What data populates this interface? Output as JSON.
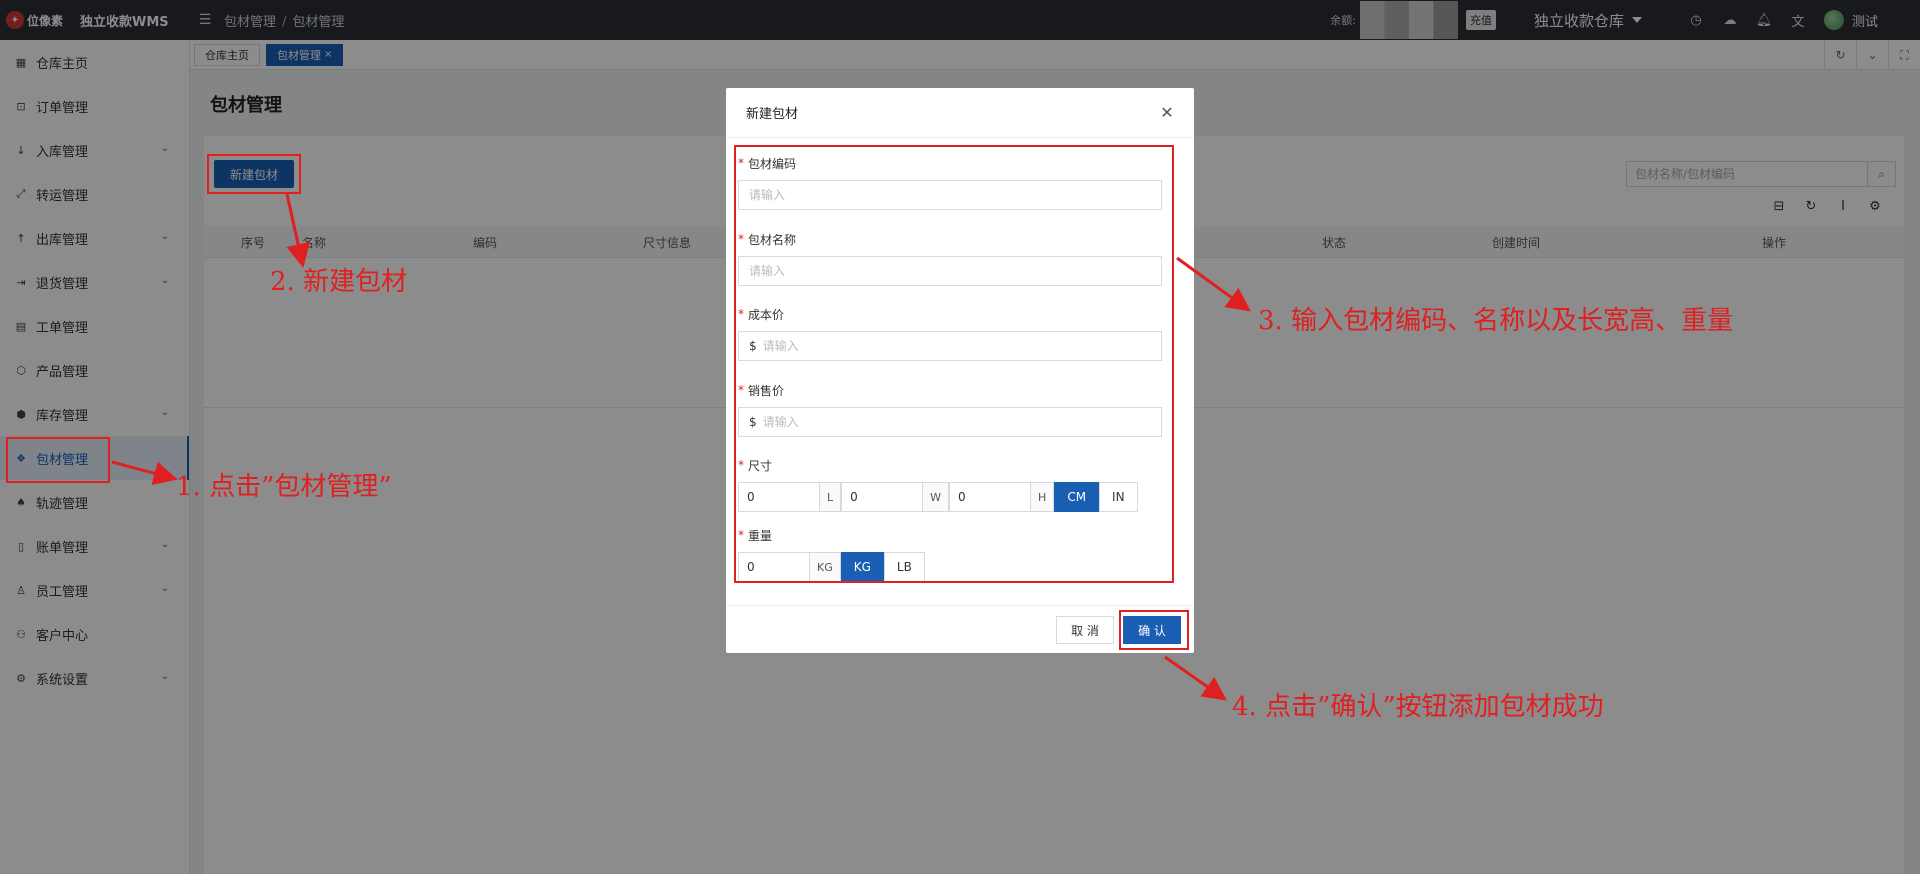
{
  "app": {
    "brand": "位像素",
    "title": "独立收款WMS"
  },
  "header": {
    "breadcrumb": [
      "包材管理",
      "包材管理"
    ],
    "balance_label": "余额:",
    "recharge_label": "充值",
    "warehouse": "独立收款仓库",
    "username": "测试",
    "icons": [
      "clock-icon",
      "cloud-upload-icon",
      "bell-icon",
      "translate-icon"
    ]
  },
  "sidebar": {
    "items": [
      {
        "label": "仓库主页",
        "icon": "grid-icon",
        "has_children": false
      },
      {
        "label": "订单管理",
        "icon": "order-icon",
        "has_children": false
      },
      {
        "label": "入库管理",
        "icon": "arrow-down-icon",
        "has_children": true
      },
      {
        "label": "转运管理",
        "icon": "transfer-icon",
        "has_children": false
      },
      {
        "label": "出库管理",
        "icon": "arrow-up-icon",
        "has_children": true
      },
      {
        "label": "退货管理",
        "icon": "return-icon",
        "has_children": true
      },
      {
        "label": "工单管理",
        "icon": "ticket-icon",
        "has_children": false
      },
      {
        "label": "产品管理",
        "icon": "cube-icon",
        "has_children": false
      },
      {
        "label": "库存管理",
        "icon": "inventory-icon",
        "has_children": true
      },
      {
        "label": "包材管理",
        "icon": "dropbox-icon",
        "has_children": false
      },
      {
        "label": "轨迹管理",
        "icon": "track-icon",
        "has_children": false
      },
      {
        "label": "账单管理",
        "icon": "bill-icon",
        "has_children": true
      },
      {
        "label": "员工管理",
        "icon": "user-icon",
        "has_children": true
      },
      {
        "label": "客户中心",
        "icon": "customer-icon",
        "has_children": false
      },
      {
        "label": "系统设置",
        "icon": "gear-icon",
        "has_children": true
      }
    ],
    "active_index": 9
  },
  "tabs": [
    {
      "label": "仓库主页",
      "active": false
    },
    {
      "label": "包材管理",
      "active": true
    }
  ],
  "page": {
    "title": "包材管理",
    "new_button": "新建包材",
    "search_placeholder": "包材名称/包材编码",
    "columns": [
      "序号",
      "名称",
      "编码",
      "尺寸信息",
      "状态",
      "创建时间",
      "操作"
    ]
  },
  "modal": {
    "title": "新建包材",
    "fields": {
      "code_label": "包材编码",
      "code_placeholder": "请输入",
      "name_label": "包材名称",
      "name_placeholder": "请输入",
      "cost_label": "成本价",
      "cost_prefix": "$",
      "cost_placeholder": "请输入",
      "price_label": "销售价",
      "price_prefix": "$",
      "price_placeholder": "请输入",
      "size_label": "尺寸",
      "length_value": "0",
      "length_unit": "L",
      "width_value": "0",
      "width_unit": "W",
      "height_value": "0",
      "height_unit": "H",
      "size_units": [
        "CM",
        "IN"
      ],
      "size_unit_selected": "CM",
      "weight_label": "重量",
      "weight_value": "0",
      "weight_unit": "KG",
      "weight_units": [
        "KG",
        "LB"
      ],
      "weight_unit_selected": "KG"
    },
    "cancel_label": "取 消",
    "ok_label": "确 认"
  },
  "annotations": {
    "step1": "1. 点击”包材管理”",
    "step2": "2. 新建包材",
    "step3": "3. 输入包材编码、名称以及长宽高、重量",
    "step4": "4. 点击”确认”按钮添加包材成功",
    "color": "#e02020"
  },
  "colors": {
    "primary": "#1a5fb4",
    "topbar": "#2b2f36",
    "annotation": "#e02020"
  }
}
